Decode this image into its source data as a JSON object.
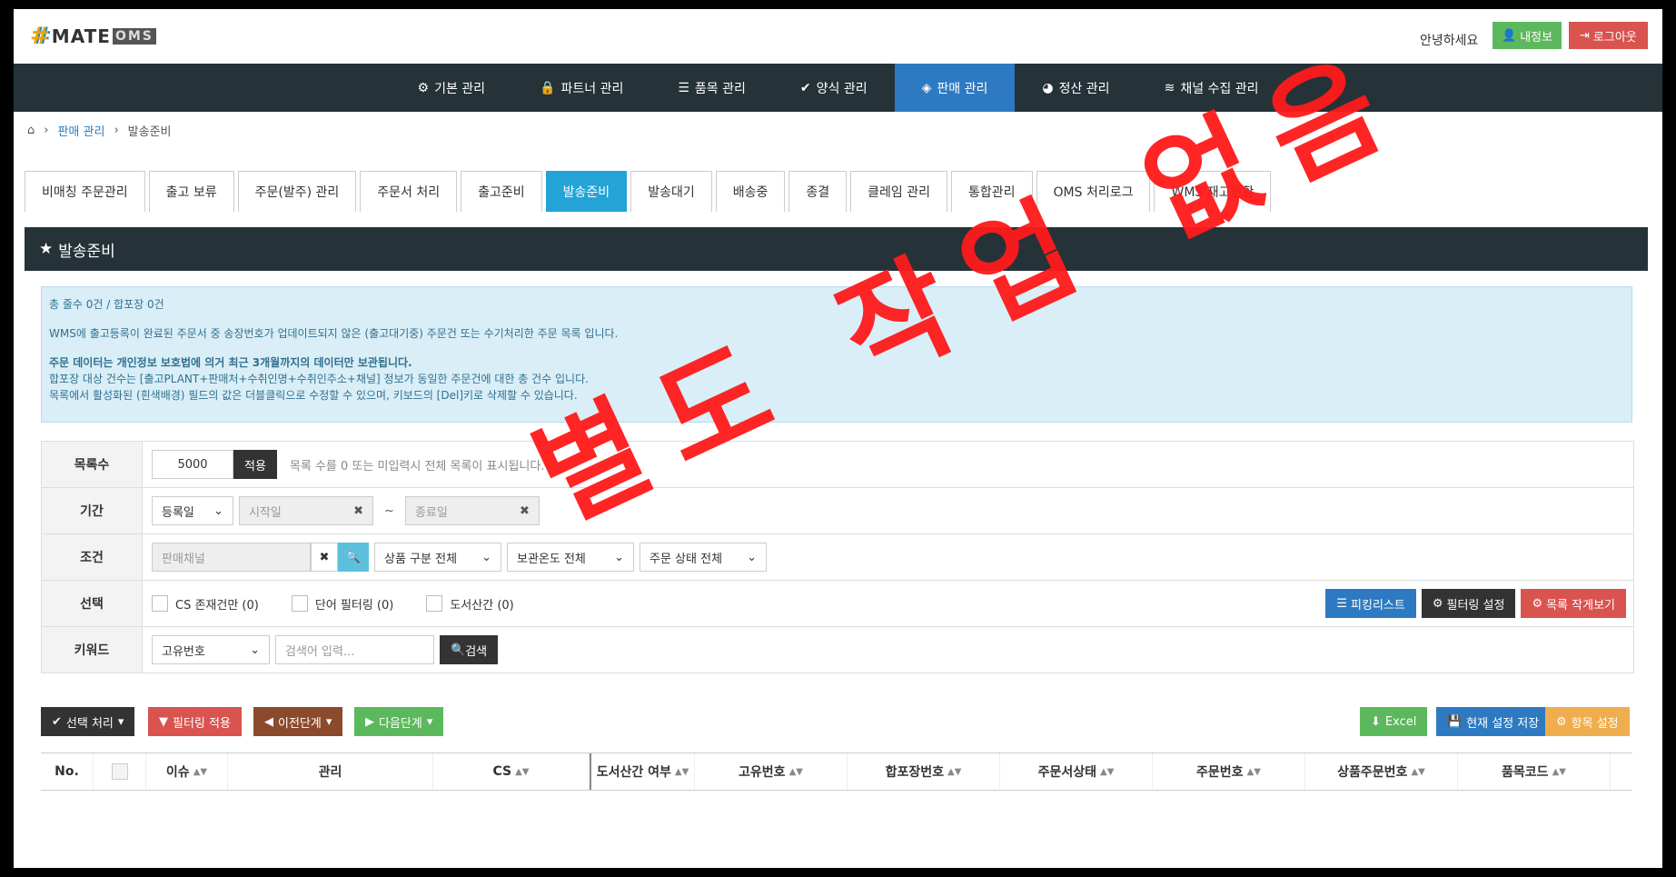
{
  "header": {
    "logo_mate": "MATE",
    "logo_oms": "OMS",
    "greeting": "안녕하세요",
    "myinfo_button": "내정보",
    "logout_button": "로그아웃"
  },
  "nav": [
    {
      "label": "기본 관리",
      "icon": "gear-icon"
    },
    {
      "label": "파트너 관리",
      "icon": "lock-icon"
    },
    {
      "label": "품목 관리",
      "icon": "list-icon"
    },
    {
      "label": "양식 관리",
      "icon": "check-icon"
    },
    {
      "label": "판매 관리",
      "icon": "diamond-icon",
      "active": true
    },
    {
      "label": "정산 관리",
      "icon": "pie-icon"
    },
    {
      "label": "채널 수집 관리",
      "icon": "rss-icon"
    }
  ],
  "breadcrumb": {
    "section": "판매 관리",
    "page": "발송준비"
  },
  "tabs": [
    "비매칭 주문관리",
    "출고 보류",
    "주문(발주) 관리",
    "주문서 처리",
    "출고준비",
    "발송준비",
    "발송대기",
    "배송중",
    "종결",
    "클레임 관리",
    "통합관리",
    "OMS 처리로그",
    "WMS 재고현황"
  ],
  "active_tab": "발송준비",
  "panel": {
    "title": "발송준비"
  },
  "info": {
    "line1": "총 줄수 0건 / 합포장 0건",
    "line2": "WMS에 출고등록이 완료된 주문서 중 송장번호가 업데이트되지 않은 (출고대기중) 주문건 또는 수기처리한 주문 목록 입니다.",
    "line3": "주문 데이터는 개인정보 보호법에 의거 최근 3개월까지의 데이터만 보관됩니다.",
    "line4": "합포장 대상 건수는 [출고PLANT+판매처+수취인명+수취인주소+채널] 정보가 동일한 주문건에 대한 총 건수 입니다.",
    "line5": "목록에서 활성화된 (흰색배경) 필드의 값은 더블클릭으로 수정할 수 있으며, 키보드의 [Del]키로 삭제할 수 있습니다."
  },
  "filters": {
    "count_label": "목록수",
    "count_value": "5000",
    "apply_button": "적용",
    "count_hint": "목록 수를 0 또는 미입력시 전체 목록이 표시됩니다.",
    "period_label": "기간",
    "period_type": "등록일",
    "start_placeholder": "시작일",
    "tilde": "~",
    "end_placeholder": "종료일",
    "cond_label": "조건",
    "channel_placeholder": "판매채널",
    "product_type": "상품 구분 전체",
    "storage_temp": "보관온도 전체",
    "order_status": "주문 상태 전체",
    "select_label": "선택",
    "check1": "CS 존재건만 (0)",
    "check2": "단어 필터링 (0)",
    "check3": "도서산간 (0)",
    "picking_button": "피킹리스트",
    "filter_settings_button": "필터링 설정",
    "list_view_button": "목록 작게보기",
    "keyword_label": "키워드",
    "keyword_type": "고유번호",
    "keyword_placeholder": "검색어 입력...",
    "search_button": "검색"
  },
  "actions": {
    "select_process": "선택 처리",
    "apply_filter": "필터링 적용",
    "prev_step": "이전단계",
    "next_step": "다음단계",
    "excel": "Excel",
    "save_settings": "현재 설정 저장",
    "column_settings": "항목 설정"
  },
  "grid_columns": [
    "No.",
    "",
    "이슈",
    "관리",
    "CS",
    "도서산간 여부",
    "고유번호",
    "합포장번호",
    "주문서상태",
    "주문번호",
    "상품주문번호",
    "품목코드"
  ],
  "stamp_text": "별도 작업 없음",
  "colors": {
    "nav_bg": "#253238",
    "active_blue": "#2d7ac2",
    "tab_active": "#23a3d6",
    "stamp": "#ff1a1a"
  }
}
